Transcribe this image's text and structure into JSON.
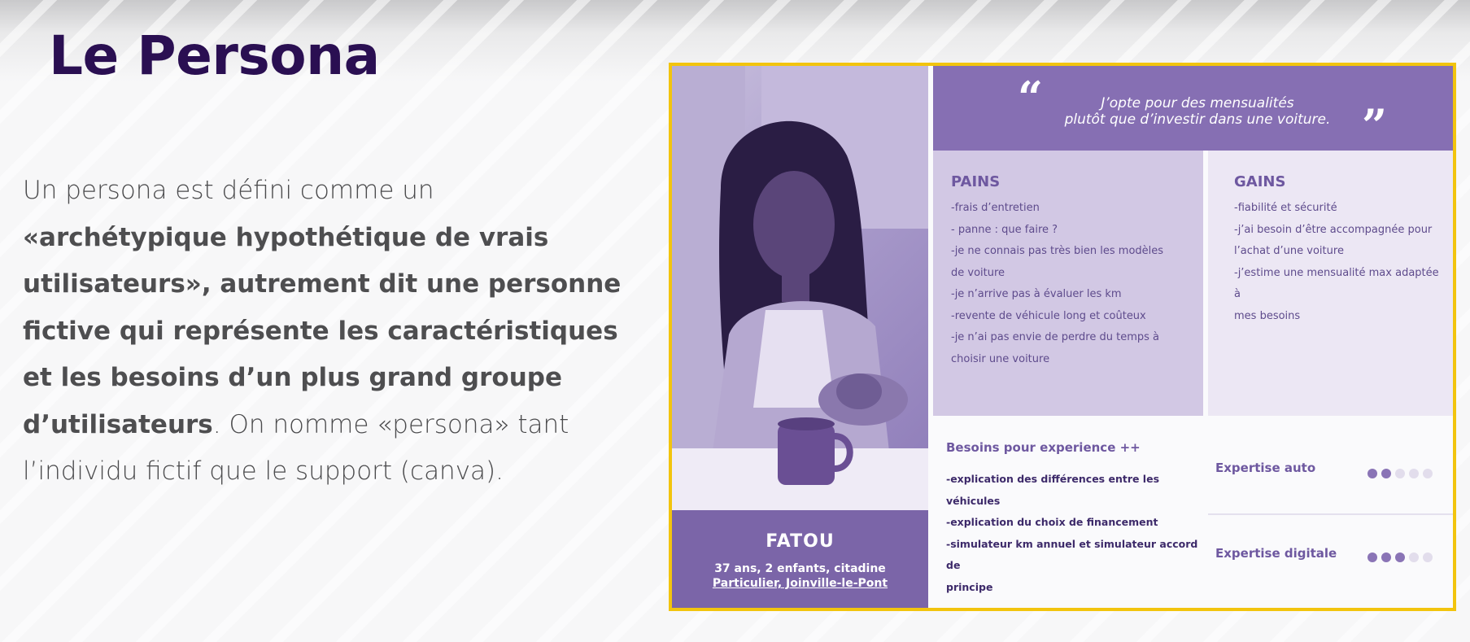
{
  "slide": {
    "title": "Le Persona",
    "body": {
      "p1": "Un persona est défini comme un ",
      "p2": "«archétypique hypothétique de vrais utilisateurs», autrement dit une personne fictive qui représente les caractéristiques et les besoins d’un plus grand groupe d’utilisateurs",
      "p3": ". On nomme «persona» tant l’individu fictif que le support (canva)."
    }
  },
  "persona": {
    "quote": {
      "open_mark": "“",
      "close_mark": "”",
      "line1": "J’opte pour des mensualités",
      "line2": "plutôt que d’investir dans une voiture."
    },
    "name": "FATOU",
    "meta_line1": "37 ans, 2 enfants, citadine",
    "meta_line2": "Particulier, Joinville-le-Pont",
    "pains": {
      "title": "PAINS",
      "items": [
        "-frais d’entretien",
        "- panne : que faire ?",
        "-je ne connais pas très bien les modèles",
        "de voiture",
        "-je n’arrive pas à évaluer les km",
        "-revente de véhicule long et coûteux",
        "-je n’ai pas envie de perdre du temps à",
        "choisir une voiture"
      ]
    },
    "gains": {
      "title": "GAINS",
      "items": [
        "-fiabilité et sécurité",
        "-j’ai besoin d’être accompagnée pour",
        "l’achat d’une voiture",
        "-j’estime une mensualité max adaptée à",
        "mes besoins"
      ]
    },
    "besoins": {
      "title": "Besoins pour experience ++",
      "items": [
        "-explication des différences entre les véhicules",
        "-explication du choix de financement",
        "-simulateur km annuel et simulateur accord de",
        "principe"
      ]
    },
    "expertise": {
      "auto_label": "Expertise auto",
      "auto_level": 2,
      "digital_label": "Expertise digitale",
      "digital_level": 3,
      "max_level": 5
    },
    "colors": {
      "accent_purple": "#866fb3",
      "frame_yellow": "#f2c40e",
      "title_purple": "#2a0f52"
    }
  }
}
